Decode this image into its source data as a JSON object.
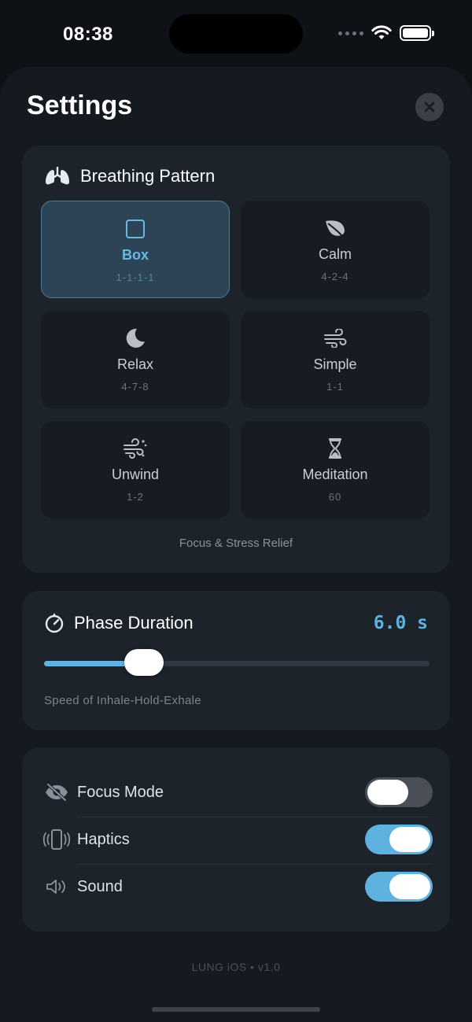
{
  "status_bar": {
    "time": "08:38"
  },
  "header": {
    "title": "Settings"
  },
  "breathing_pattern": {
    "label": "Breathing Pattern",
    "selected": "Box",
    "caption": "Focus & Stress Relief",
    "patterns": [
      {
        "name": "Box",
        "sub": "1-1-1-1",
        "icon": "square-icon"
      },
      {
        "name": "Calm",
        "sub": "4-2-4",
        "icon": "leaf-icon"
      },
      {
        "name": "Relax",
        "sub": "4-7-8",
        "icon": "moon-icon"
      },
      {
        "name": "Simple",
        "sub": "1-1",
        "icon": "wind-icon"
      },
      {
        "name": "Unwind",
        "sub": "1-2",
        "icon": "wind-sparkle-icon"
      },
      {
        "name": "Meditation",
        "sub": "60",
        "icon": "hourglass-icon"
      }
    ]
  },
  "phase_duration": {
    "label": "Phase Duration",
    "value_text": "6.0 s",
    "slider_fraction": 0.26,
    "caption": "Speed of Inhale-Hold-Exhale"
  },
  "toggles": [
    {
      "label": "Focus Mode",
      "on": false,
      "icon": "eye-slash-icon"
    },
    {
      "label": "Haptics",
      "on": true,
      "icon": "phone-vibrate-icon"
    },
    {
      "label": "Sound",
      "on": true,
      "icon": "speaker-icon"
    }
  ],
  "footer": {
    "text": "LUNG iOS • v1.0"
  },
  "colors": {
    "accent": "#5fb1e0",
    "background": "#151a21",
    "card": "#1d232b"
  }
}
